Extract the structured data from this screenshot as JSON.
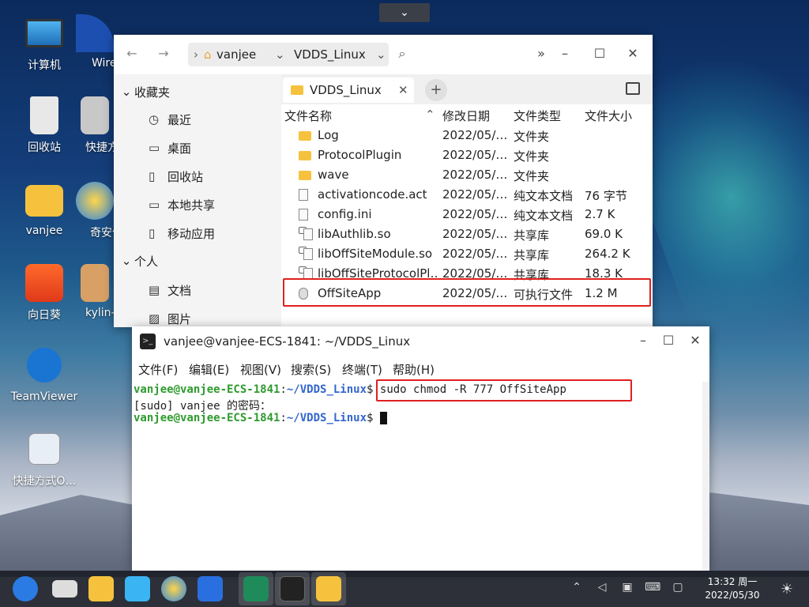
{
  "desktop": {
    "icons": [
      {
        "label": "计算机"
      },
      {
        "label": "Wire"
      },
      {
        "label": "回收站"
      },
      {
        "label": "快捷方式"
      },
      {
        "label": "vanjee"
      },
      {
        "label": "奇安信可…"
      },
      {
        "label": "向日葵"
      },
      {
        "label": "kylin-nm…"
      },
      {
        "label": "TeamViewer"
      },
      {
        "label": "快捷方式O…"
      }
    ]
  },
  "file_manager": {
    "path": [
      "vanjee",
      "VDDS_Linux"
    ],
    "sidebar": {
      "favorites_label": "收藏夹",
      "favorites": [
        "最近",
        "桌面",
        "回收站",
        "本地共享",
        "移动应用"
      ],
      "personal_label": "个人",
      "personal": [
        "文档",
        "图片"
      ]
    },
    "tab_label": "VDDS_Linux",
    "columns": [
      "文件名称",
      "修改日期",
      "文件类型",
      "文件大小"
    ],
    "rows": [
      {
        "name": "Log",
        "date": "2022/05/…",
        "type": "文件夹",
        "size": "",
        "kind": "folder"
      },
      {
        "name": "ProtocolPlugin",
        "date": "2022/05/…",
        "type": "文件夹",
        "size": "",
        "kind": "folder"
      },
      {
        "name": "wave",
        "date": "2022/05/…",
        "type": "文件夹",
        "size": "",
        "kind": "folder"
      },
      {
        "name": "activationcode.act",
        "date": "2022/05/…",
        "type": "纯文本文档",
        "size": "76 字节",
        "kind": "file"
      },
      {
        "name": "config.ini",
        "date": "2022/05/…",
        "type": "纯文本文档",
        "size": "2.7 K",
        "kind": "file"
      },
      {
        "name": "libAuthlib.so",
        "date": "2022/05/…",
        "type": "共享库",
        "size": "69.0 K",
        "kind": "lib"
      },
      {
        "name": "libOffSiteModule.so",
        "date": "2022/05/…",
        "type": "共享库",
        "size": "264.2 K",
        "kind": "lib"
      },
      {
        "name": "libOffSiteProtocolPl…",
        "date": "2022/05/…",
        "type": "共享库",
        "size": "18.3 K",
        "kind": "lib"
      },
      {
        "name": "OffSiteApp",
        "date": "2022/05/…",
        "type": "可执行文件",
        "size": "1.2 M",
        "kind": "exec"
      }
    ]
  },
  "terminal": {
    "title": "vanjee@vanjee-ECS-1841: ~/VDDS_Linux",
    "menu": [
      "文件(F)",
      "编辑(E)",
      "视图(V)",
      "搜索(S)",
      "终端(T)",
      "帮助(H)"
    ],
    "prompt_user": "vanjee@vanjee-ECS-1841",
    "prompt_path": "~/VDDS_Linux",
    "command": "$ sudo chmod -R 777 OffSiteApp",
    "password_prompt": "[sudo] vanjee 的密码：",
    "prompt_end": "$ "
  },
  "taskbar": {
    "time": "13:32 周一",
    "date": "2022/05/30"
  },
  "colors": {
    "highlight": "#e02020",
    "prompt_user": "#2e9b2e",
    "prompt_path": "#3366cc",
    "folder": "#f6c23e"
  }
}
